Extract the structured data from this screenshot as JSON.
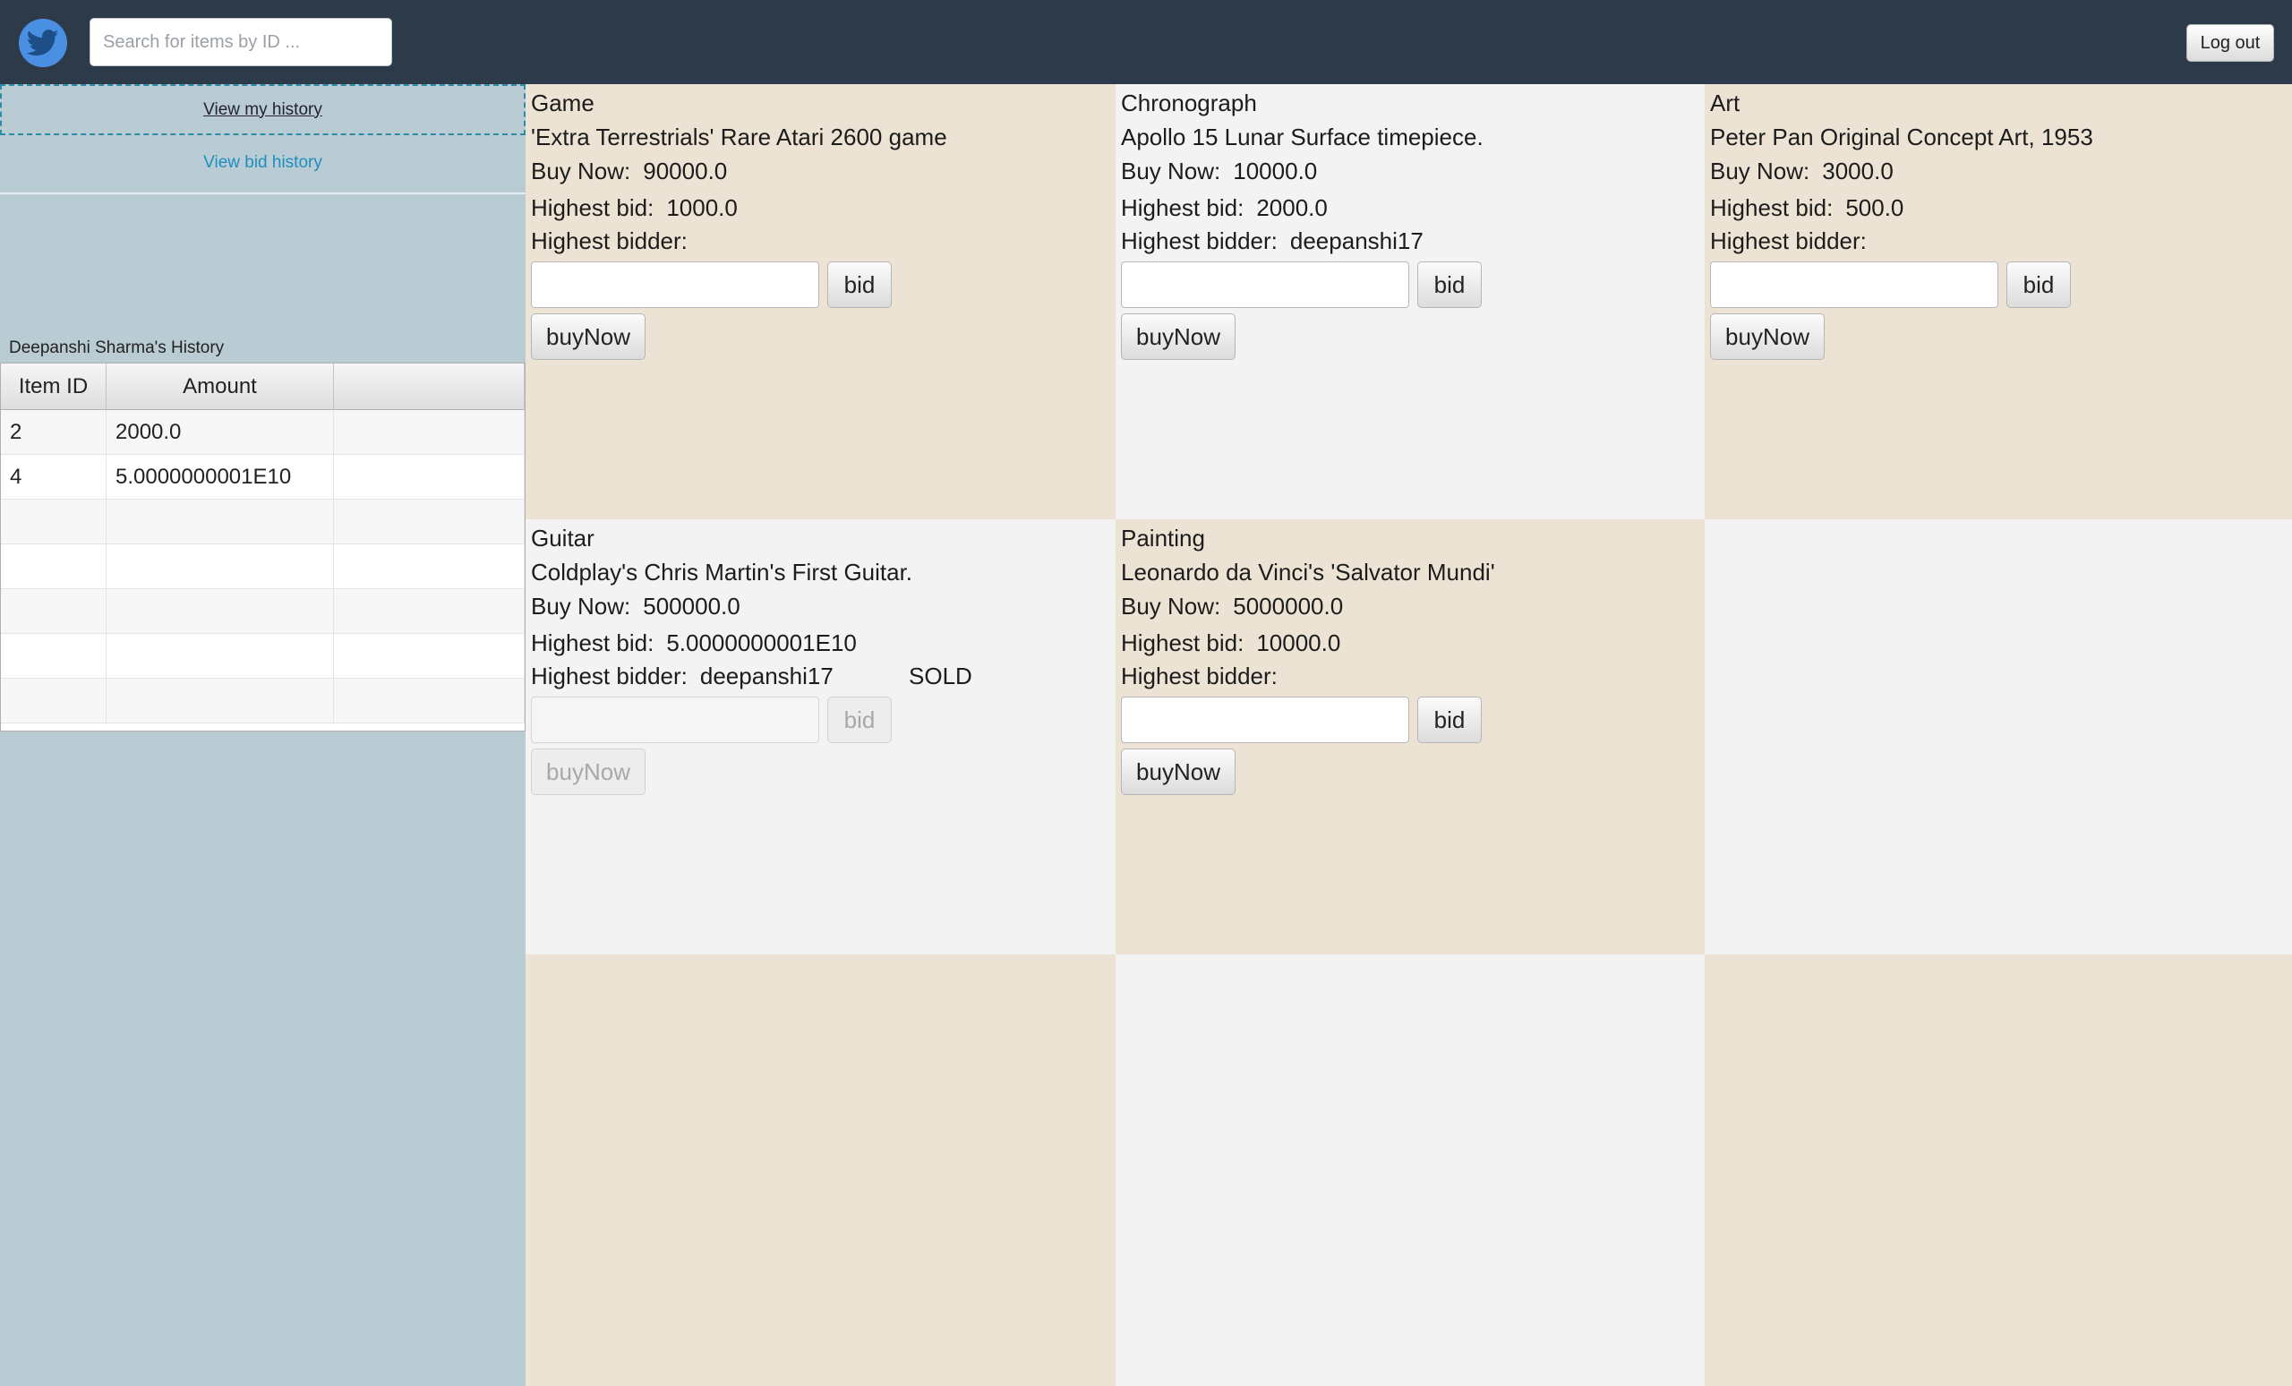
{
  "header": {
    "logo_icon": "twitter-bird-icon",
    "search": {
      "placeholder": "Search for items by ID ...",
      "value": ""
    },
    "logout_label": "Log out",
    "background": "#2d3a4a"
  },
  "sidebar": {
    "view_my_history": "View my history",
    "view_bid_history": "View bid history",
    "history_title": "Deepanshi Sharma's History",
    "table": {
      "headers": [
        "Item ID",
        "Amount",
        ""
      ],
      "rows": [
        {
          "item_id": "2",
          "amount": "2000.0"
        },
        {
          "item_id": "4",
          "amount": "5.0000000001E10"
        }
      ]
    }
  },
  "labels": {
    "buy_now": "Buy Now:",
    "highest_bid": "Highest bid:",
    "highest_bidder": "Highest bidder:",
    "bid_button": "bid",
    "buy_now_button": "buyNow"
  },
  "items": [
    {
      "category": "Game",
      "description": "'Extra Terrestrials' Rare Atari 2600 game",
      "buy_now": "90000.0",
      "highest_bid": "1000.0",
      "highest_bidder": "",
      "status": ""
    },
    {
      "category": "Chronograph",
      "description": "Apollo 15 Lunar Surface timepiece.",
      "buy_now": "10000.0",
      "highest_bid": "2000.0",
      "highest_bidder": "deepanshi17",
      "status": ""
    },
    {
      "category": "Art",
      "description": "Peter Pan Original Concept Art, 1953",
      "buy_now": "3000.0",
      "highest_bid": "500.0",
      "highest_bidder": "",
      "status": ""
    },
    {
      "category": "Guitar",
      "description": "Coldplay's Chris Martin's First Guitar.",
      "buy_now": "500000.0",
      "highest_bid": "5.0000000001E10",
      "highest_bidder": "deepanshi17",
      "status": "SOLD"
    },
    {
      "category": "Painting",
      "description": "Leonardo da Vinci's 'Salvator Mundi'",
      "buy_now": "5000000.0",
      "highest_bid": "10000.0",
      "highest_bidder": "",
      "status": ""
    }
  ],
  "colors": {
    "beige": "#ede3d4",
    "grey": "#f3f3f3",
    "sidebar": "#b9cbd3",
    "link": "#1f8fc0"
  }
}
